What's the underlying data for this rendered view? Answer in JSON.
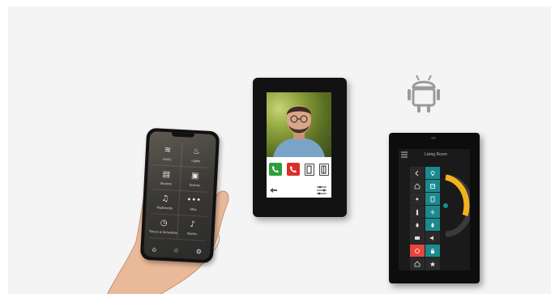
{
  "phone": {
    "tiles": [
      {
        "icon": "hvac-icon",
        "glyph": "≋",
        "label": "HVAC"
      },
      {
        "icon": "lights-icon",
        "glyph": "♨",
        "label": "Lights"
      },
      {
        "icon": "shutters-icon",
        "glyph": "▤",
        "label": "Shutters"
      },
      {
        "icon": "scenes-icon",
        "glyph": "▣",
        "label": "Scenes"
      },
      {
        "icon": "multimedia-icon",
        "glyph": "♫",
        "label": "Multimedia"
      },
      {
        "icon": "more-icon",
        "glyph": "•••",
        "label": "Misc"
      },
      {
        "icon": "timer-icon",
        "glyph": "◷",
        "label": "Timers & Schedules"
      },
      {
        "icon": "alarms-icon",
        "glyph": "♪",
        "label": "Alarms"
      }
    ],
    "bottom": {
      "home": "⌂",
      "favorites": "☆",
      "settings": "⚙"
    }
  },
  "tablet": {
    "header_text": "Living Room"
  },
  "colors": {
    "accent_teal": "#1b8a8f",
    "accept_green": "#2e9e3c",
    "reject_red": "#d9302a",
    "gauge_yellow": "#f2b21d"
  }
}
